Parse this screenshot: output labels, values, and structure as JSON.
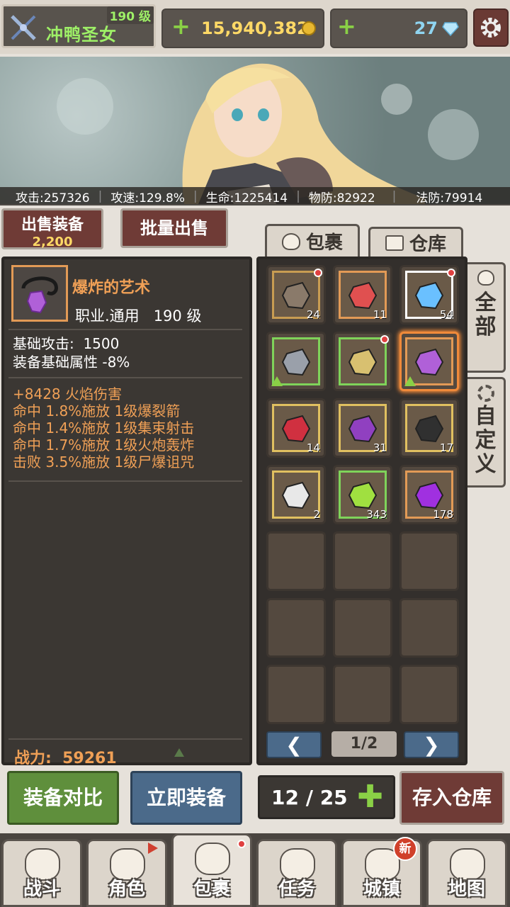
{
  "player": {
    "name": "冲鸭圣女",
    "level": "190 级"
  },
  "currency": {
    "gold": "15,940,382",
    "gems": "27"
  },
  "stats": [
    "攻击:257326",
    "攻速:129.8%",
    "生命:1225414",
    "物防:82922",
    "法防:79914"
  ],
  "sell": {
    "label": "出售装备",
    "price": "2,200"
  },
  "bulk_sell_label": "批量出售",
  "tabs": {
    "bag": "包裹",
    "storage": "仓库"
  },
  "side_tabs": {
    "all": "全部",
    "custom": "自定义"
  },
  "item": {
    "name": "爆炸的艺术",
    "class_level": "职业.通用   190 级",
    "base_lines": [
      "基础攻击:  1500",
      "装备基础属性 -8%"
    ],
    "attrs": [
      "+8428 火焰伤害",
      "命中 1.8%施放 1级爆裂箭",
      "命中 1.4%施放 1级集束射击",
      "命中 1.7%施放 1级火炮轰炸",
      "击败 3.5%施放 1级尸爆诅咒"
    ],
    "power": "战力:  59261"
  },
  "inventory": [
    {
      "name": "treasure-chest-icon",
      "count": "24",
      "dot": true,
      "frame": "#c89c52",
      "color": "#8a7a6a"
    },
    {
      "name": "red-crystal-icon",
      "count": "11",
      "dot": false,
      "frame": "#e29a56",
      "color": "#e05050"
    },
    {
      "name": "ice-crystal-icon",
      "count": "54",
      "dot": true,
      "frame": "#ffffff",
      "color": "#6ac0ff"
    },
    {
      "name": "armor-icon",
      "count": "",
      "dot": false,
      "frame": "#7fd35a",
      "color": "#9aa0aa",
      "arrow": true
    },
    {
      "name": "bow-icon",
      "count": "",
      "dot": true,
      "frame": "#7fd35a",
      "color": "#d8c070"
    },
    {
      "name": "amulet-icon",
      "count": "",
      "dot": false,
      "frame": "#e29a56",
      "color": "#b060d8",
      "arrow": true,
      "selected": true
    },
    {
      "name": "red-ore-icon",
      "count": "14",
      "dot": false,
      "frame": "#e0c060",
      "color": "#d03040"
    },
    {
      "name": "purple-ore-icon",
      "count": "31",
      "dot": false,
      "frame": "#e0c060",
      "color": "#9040c0"
    },
    {
      "name": "black-ore-icon",
      "count": "17",
      "dot": false,
      "frame": "#e0c060",
      "color": "#303030"
    },
    {
      "name": "white-ore-icon",
      "count": "2",
      "dot": false,
      "frame": "#e0c060",
      "color": "#e8e8e8"
    },
    {
      "name": "green-orb-icon",
      "count": "343",
      "dot": false,
      "frame": "#7fd35a",
      "color": "#a0e040"
    },
    {
      "name": "purple-orb-icon",
      "count": "178",
      "dot": false,
      "frame": "#e29a56",
      "color": "#a030e0"
    }
  ],
  "pager": {
    "text": "1/2",
    "prev": "❮",
    "next": "❯"
  },
  "actions": {
    "compare": "装备对比",
    "equip": "立即装备",
    "deposit": "存入仓库"
  },
  "capacity": {
    "text": "12 / 25",
    "plus": "✚"
  },
  "nav": [
    {
      "label": "战斗",
      "icon": "sword-icon"
    },
    {
      "label": "角色",
      "icon": "character-icon"
    },
    {
      "label": "包裹",
      "icon": "bag-icon"
    },
    {
      "label": "任务",
      "icon": "quest-icon"
    },
    {
      "label": "城镇",
      "icon": "castle-icon"
    },
    {
      "label": "地图",
      "icon": "map-icon"
    }
  ],
  "nav_badge": "新"
}
